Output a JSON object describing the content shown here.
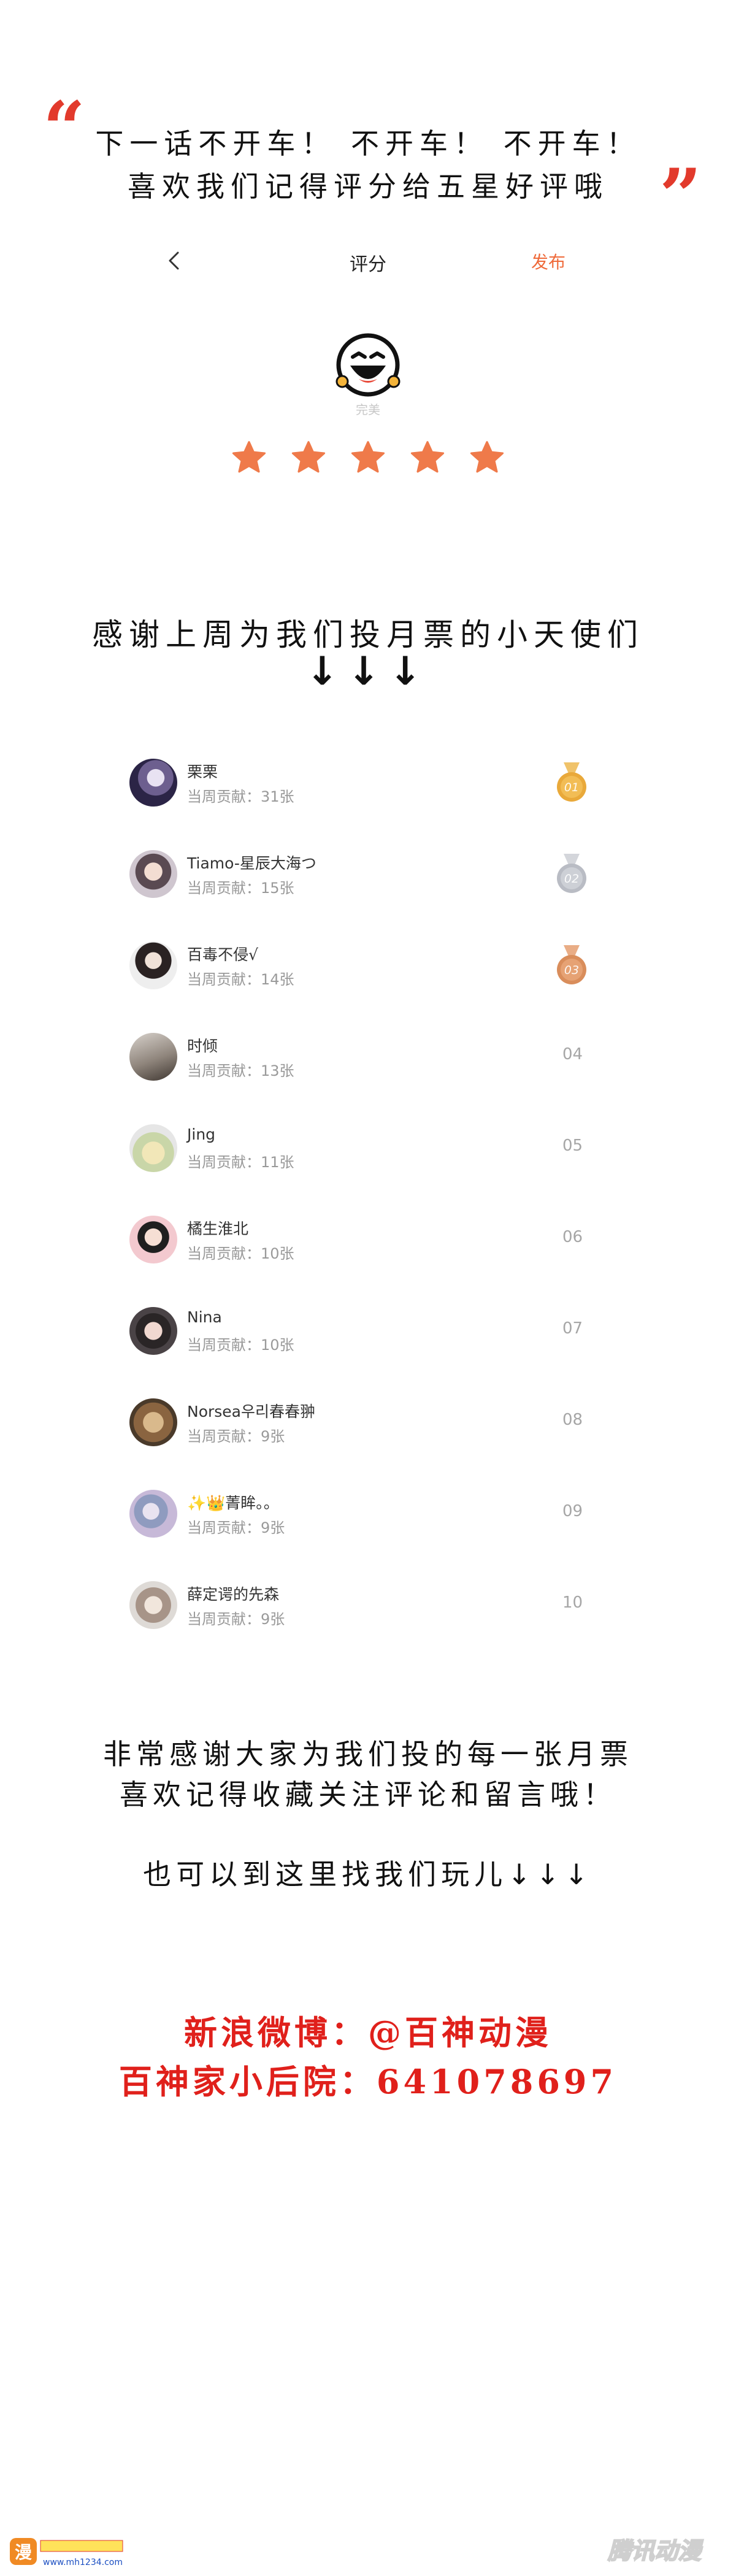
{
  "banner": {
    "line1": "下一话不开车！ 不开车！ 不开车！",
    "line2": "喜欢我们记得评分给五星好评哦"
  },
  "rating": {
    "title": "评分",
    "publish_label": "发布",
    "face_label": "完美",
    "stars_filled": 5,
    "stars_total": 5,
    "star_color": "#ef7a4a"
  },
  "thanks": {
    "title": "感谢上周为我们投月票的小天使们",
    "arrows": "↓↓↓"
  },
  "leaderboard": [
    {
      "name": "栗栗",
      "contribution": "当周贡献：31张",
      "rank": "01",
      "medal": "gold"
    },
    {
      "name": "Tiamo-星辰大海つ",
      "contribution": "当周贡献：15张",
      "rank": "02",
      "medal": "silver"
    },
    {
      "name": "百毒不侵√",
      "contribution": "当周贡献：14张",
      "rank": "03",
      "medal": "bronze"
    },
    {
      "name": "时倾",
      "contribution": "当周贡献：13张",
      "rank": "04",
      "medal": ""
    },
    {
      "name": "Jing",
      "contribution": "当周贡献：11张",
      "rank": "05",
      "medal": ""
    },
    {
      "name": "橘生淮北",
      "contribution": "当周贡献：10张",
      "rank": "06",
      "medal": ""
    },
    {
      "name": "Nina",
      "contribution": "当周贡献：10张",
      "rank": "07",
      "medal": ""
    },
    {
      "name": "Norsea우리春春翀",
      "contribution": "当周贡献：9张",
      "rank": "08",
      "medal": ""
    },
    {
      "name": "✨👑菁眸。。",
      "contribution": "当周贡献：9张",
      "rank": "09",
      "medal": ""
    },
    {
      "name": "薛定谔的先森",
      "contribution": "当周贡献：9张",
      "rank": "10",
      "medal": ""
    }
  ],
  "bottom": {
    "line1": "非常感谢大家为我们投的每一张月票",
    "line2": "喜欢记得收藏关注评论和留言哦！",
    "line3": "也可以到这里找我们玩儿↓↓↓",
    "weibo": "新浪微博：@百神动漫",
    "group": "百神家小后院：641078697"
  },
  "watermarks": {
    "left_text": "www.mh1234.com",
    "right_text": "腾讯动漫"
  },
  "colors": {
    "accent": "#ef6a3a",
    "quote_red": "#e23a2c",
    "contact_red": "#e0201b",
    "gold": "#e9a93a",
    "silver": "#b9bcc4",
    "bronze": "#d98d5b"
  }
}
